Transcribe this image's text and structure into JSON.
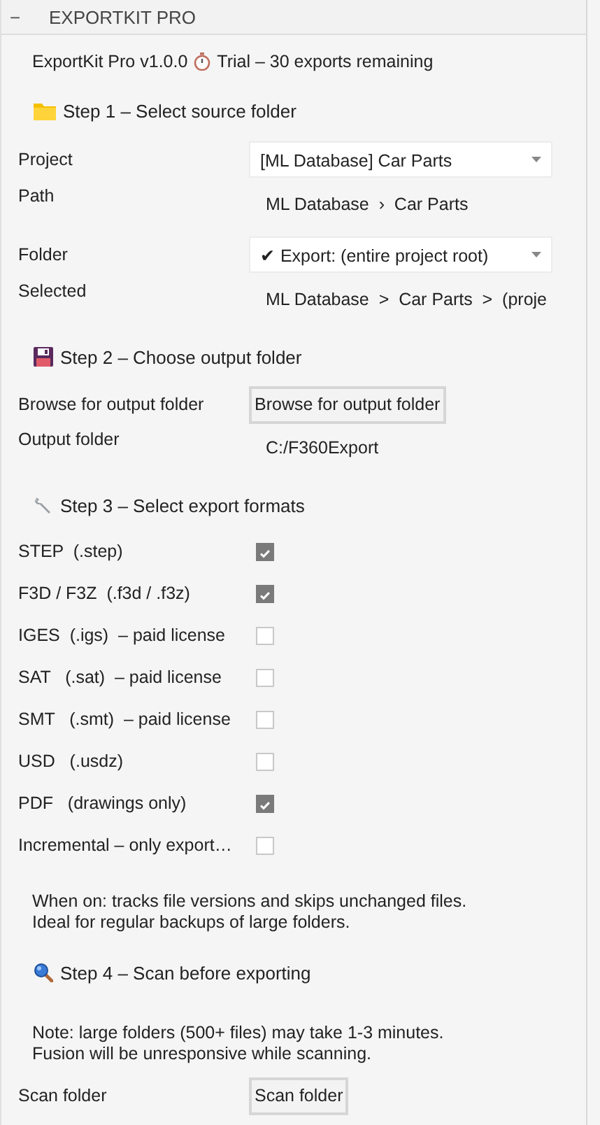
{
  "panel": {
    "toggle": "−",
    "title": "EXPORTKIT PRO"
  },
  "rows": [
    {
      "kind": "info",
      "text": "ExportKit Pro v1.0.0",
      "extra": "Trial – 30 exports remaining"
    },
    {
      "kind": "heading",
      "text": "Step 1 – Select source folder"
    },
    {
      "kind": "dropdown",
      "label": "Project",
      "value": "[ML Database]  Car Parts"
    },
    {
      "kind": "text",
      "label": "Path",
      "value": "ML Database  ›  Car Parts"
    },
    {
      "kind": "dropdown",
      "label": "Folder",
      "value": "✔  Export:  (entire project root)"
    },
    {
      "kind": "text",
      "label": "Selected",
      "value": "ML Database  >  Car Parts  >  (proje"
    },
    {
      "kind": "heading",
      "text": "Step 2 – Choose output folder"
    },
    {
      "kind": "button",
      "label": "Browse for output folder",
      "value": "Browse for output folder"
    },
    {
      "kind": "text",
      "label": "Output folder",
      "value": "C:/F360Export"
    },
    {
      "kind": "heading",
      "text": "Step 3 – Select export formats"
    },
    {
      "kind": "checkbox",
      "label": "STEP  (.step)",
      "checked": true
    },
    {
      "kind": "checkbox",
      "label": "F3D / F3Z  (.f3d / .f3z)",
      "checked": true
    },
    {
      "kind": "checkbox",
      "label": "IGES  (.igs)  – paid license",
      "checked": false
    },
    {
      "kind": "checkbox",
      "label": "SAT   (.sat)  – paid license",
      "checked": false
    },
    {
      "kind": "checkbox",
      "label": "SMT   (.smt)  – paid license",
      "checked": false
    },
    {
      "kind": "checkbox",
      "label": "USD   (.usdz)",
      "checked": false
    },
    {
      "kind": "checkbox",
      "label": "PDF   (drawings only)",
      "checked": true
    },
    {
      "kind": "checkbox",
      "label": "Incremental – only export…",
      "checked": false
    },
    {
      "kind": "note",
      "lines": [
        "When on: tracks file versions and skips unchanged files.",
        "Ideal for regular backups of large folders."
      ]
    },
    {
      "kind": "heading",
      "text": "Step 4 – Scan before exporting"
    },
    {
      "kind": "note",
      "lines": [
        "Note: large folders (500+ files) may take 1-3 minutes.",
        "Fusion will be unresponsive while scanning."
      ]
    },
    {
      "kind": "button",
      "label": "Scan folder",
      "value": "Scan folder"
    }
  ]
}
